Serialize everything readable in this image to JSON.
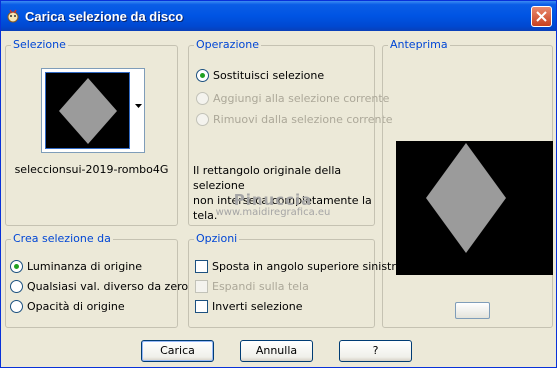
{
  "window": {
    "title": "Carica selezione da disco"
  },
  "selezione": {
    "label": "Selezione",
    "file_name": "seleccionsui-2019-rombo4G"
  },
  "operazione": {
    "label": "Operazione",
    "options": [
      {
        "label": "Sostituisci selezione",
        "selected": true,
        "enabled": true
      },
      {
        "label": "Aggiungi alla selezione corrente",
        "selected": false,
        "enabled": false
      },
      {
        "label": "Rimuovi dalla selezione corrente",
        "selected": false,
        "enabled": false
      }
    ],
    "info_line1": "Il rettangolo originale della selezione",
    "info_line2": "non interseca completamente la tela."
  },
  "anteprima": {
    "label": "Anteprima"
  },
  "crea": {
    "label": "Crea selezione da",
    "options": [
      {
        "label": "Luminanza di origine",
        "selected": true
      },
      {
        "label": "Qualsiasi val. diverso da zero",
        "selected": false
      },
      {
        "label": "Opacità di origine",
        "selected": false
      }
    ]
  },
  "opzioni": {
    "label": "Opzioni",
    "items": [
      {
        "label": "Sposta in angolo superiore sinistro",
        "checked": false,
        "enabled": true
      },
      {
        "label": "Espandi sulla tela",
        "checked": false,
        "enabled": false
      },
      {
        "label": "Inverti selezione",
        "checked": false,
        "enabled": true
      }
    ]
  },
  "buttons": {
    "load": "Carica",
    "cancel": "Annulla",
    "help": "?"
  },
  "watermark": {
    "line1": "Pinuccia",
    "line2": "www.maidiregrafica.eu"
  },
  "colors": {
    "titlebar": "#0054E3",
    "group_label": "#0046D5",
    "diamond": "#9B9B9B",
    "radio_dot": "#21A121"
  }
}
